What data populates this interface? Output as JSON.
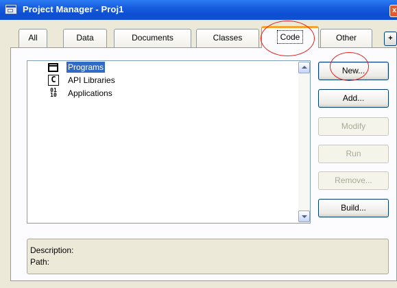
{
  "window": {
    "title": "Project Manager - Proj1",
    "close_glyph": "x"
  },
  "tabs": [
    {
      "label": "All",
      "active": false
    },
    {
      "label": "Data",
      "active": false
    },
    {
      "label": "Documents",
      "active": false
    },
    {
      "label": "Classes",
      "active": false
    },
    {
      "label": "Code",
      "active": true
    },
    {
      "label": "Other",
      "active": false
    }
  ],
  "tab_scroll_glyph": "+",
  "tree": {
    "items": [
      {
        "label": "Programs",
        "icon": "program-icon",
        "selected": true
      },
      {
        "label": "API Libraries",
        "icon": "api-library-icon",
        "selected": false
      },
      {
        "label": "Applications",
        "icon": "application-icon",
        "selected": false
      }
    ],
    "api_icon_glyph": "C",
    "apps_icon_top": "01",
    "apps_icon_bottom": "10"
  },
  "buttons": {
    "new": {
      "label": "New...",
      "enabled": true
    },
    "add": {
      "label": "Add...",
      "enabled": true
    },
    "modify": {
      "label": "Modify",
      "enabled": false
    },
    "run": {
      "label": "Run",
      "enabled": false
    },
    "remove": {
      "label": "Remove...",
      "enabled": false
    },
    "build": {
      "label": "Build...",
      "enabled": true
    }
  },
  "details": {
    "description_label": "Description:",
    "path_label": "Path:"
  },
  "colors": {
    "annotation_circle": "#e8201c",
    "selection": "#316ac5",
    "active_tab_accent": "#f2a52c"
  }
}
